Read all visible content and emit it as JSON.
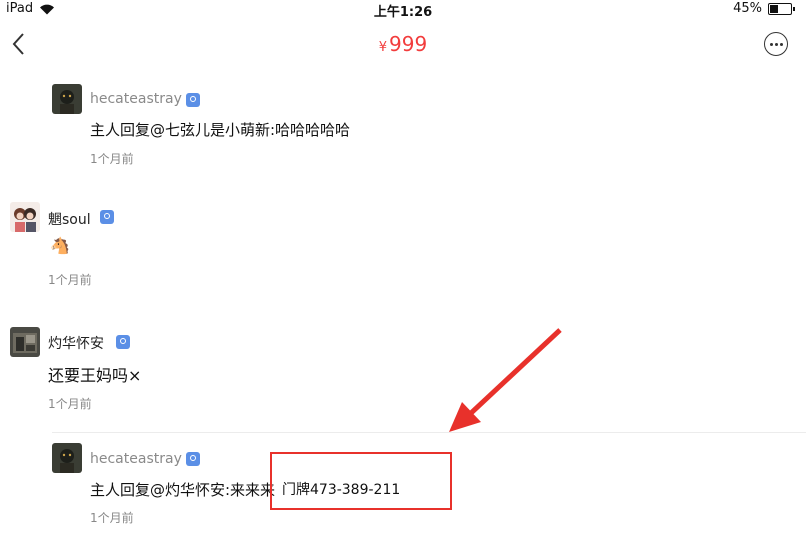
{
  "status_bar": {
    "device": "iPad",
    "time": "上午1:26",
    "battery_text": "45%",
    "battery_level": 0.45
  },
  "nav": {
    "currency": "¥",
    "price": "999",
    "back_icon": "chevron-left-icon",
    "more_icon": "more-circle-icon"
  },
  "comments": [
    {
      "user": "hecateastray",
      "text": "主人回复@七弦儿是小萌新:哈哈哈哈哈",
      "time": "1个月前"
    },
    {
      "user": "魍soul",
      "text": "🐴",
      "time": "1个月前"
    },
    {
      "user": "灼华怀安",
      "text": "还要王妈吗×",
      "time": "1个月前"
    },
    {
      "user": "hecateastray",
      "text": "主人回复@灼华怀安:来来来",
      "extra": "门牌473-389-211",
      "time": "1个月前"
    }
  ],
  "colors": {
    "accent": "#f23c3c",
    "badge": "#5b8fe6",
    "annotation": "#e8312b"
  }
}
